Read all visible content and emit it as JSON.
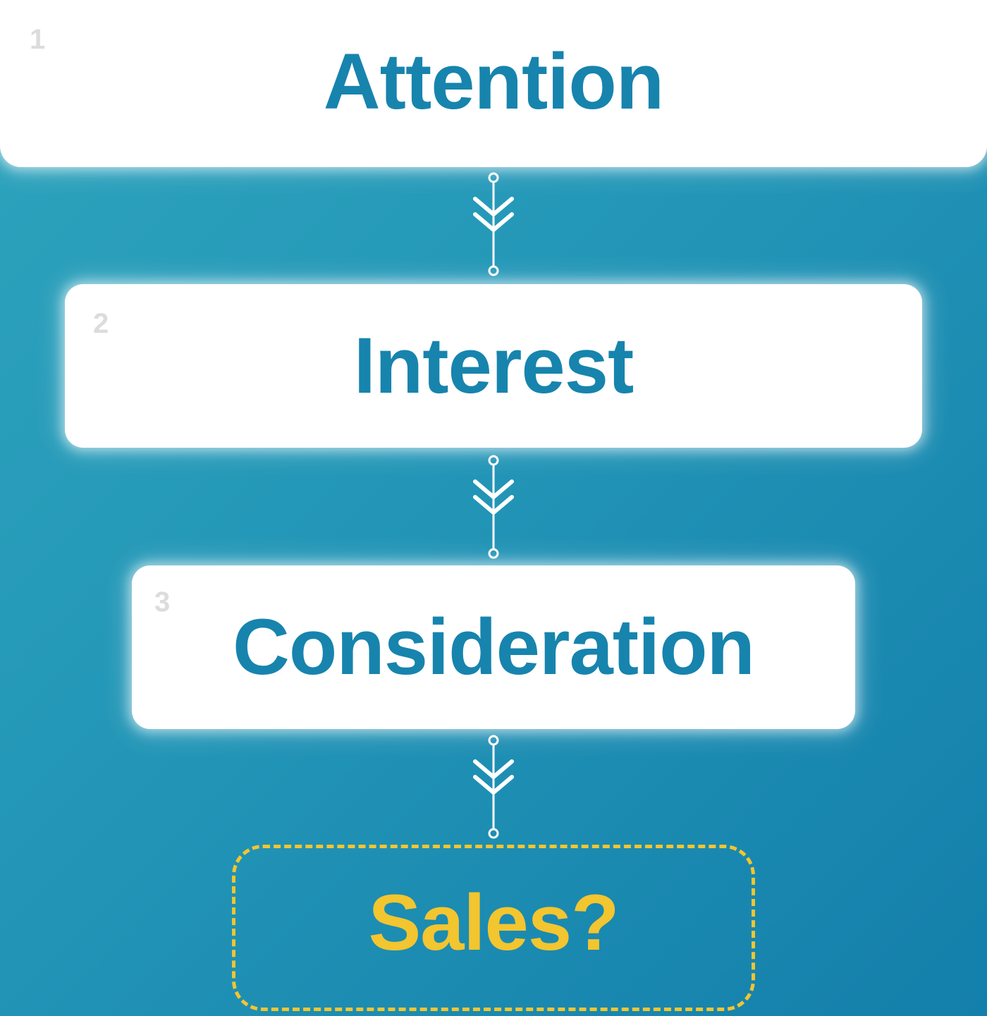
{
  "steps": [
    {
      "number": "1",
      "label": "Attention"
    },
    {
      "number": "2",
      "label": "Interest"
    },
    {
      "number": "3",
      "label": "Consideration"
    }
  ],
  "outcome": {
    "label": "Sales?"
  },
  "colors": {
    "background_start": "#2ea4bd",
    "background_end": "#137fab",
    "step_text": "#1784ad",
    "step_number": "#dcdcdc",
    "outcome_accent": "#f3c52f",
    "box_fill": "#ffffff",
    "connector": "#ffffff"
  },
  "connectors": [
    {
      "icon": "double-chevron-down-icon"
    },
    {
      "icon": "double-chevron-down-icon"
    },
    {
      "icon": "double-chevron-down-icon"
    }
  ]
}
